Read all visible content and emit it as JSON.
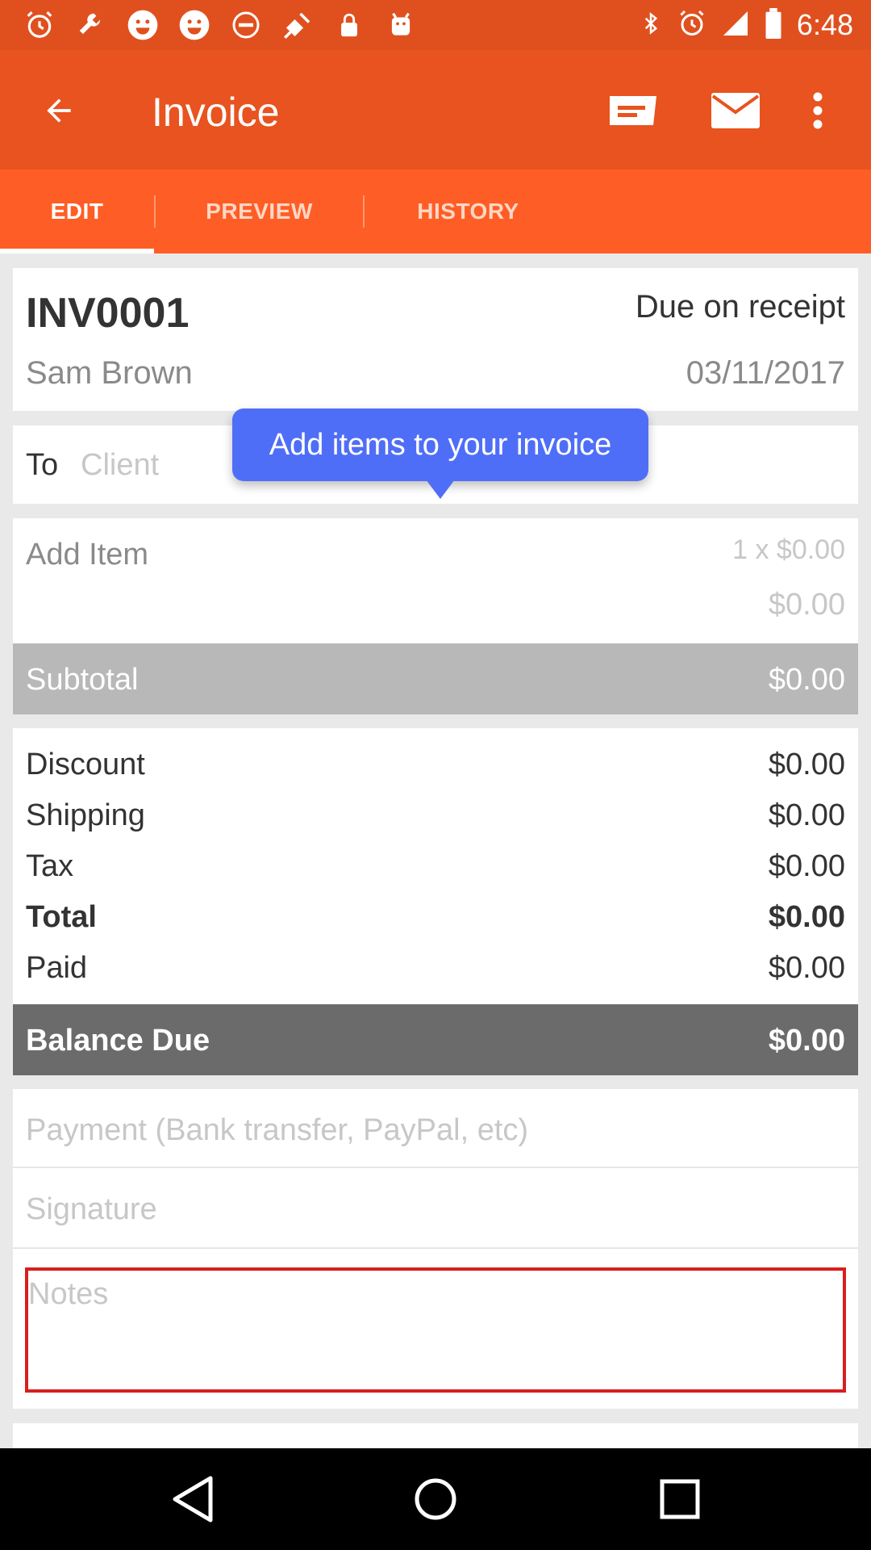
{
  "status_bar": {
    "time": "6:48",
    "left_icons": [
      "alarm-icon",
      "wrench-icon",
      "smiley-icon",
      "smiley-icon",
      "no-entry-icon",
      "satellite-fake-gps-icon",
      "lock-icon",
      "android-icon"
    ],
    "right_icons": [
      "bluetooth-icon",
      "alarm-icon",
      "signal-icon",
      "battery-icon"
    ]
  },
  "app_bar": {
    "title": "Invoice",
    "actions": [
      "save-icon",
      "mail-icon",
      "more-vert-icon"
    ]
  },
  "tabs": [
    {
      "label": "EDIT",
      "active": true
    },
    {
      "label": "PREVIEW",
      "active": false
    },
    {
      "label": "HISTORY",
      "active": false
    }
  ],
  "header": {
    "invoice_number": "INV0001",
    "terms": "Due on receipt",
    "from_name": "Sam Brown",
    "date": "03/11/2017"
  },
  "client": {
    "to_label": "To",
    "placeholder": "Client"
  },
  "tooltip": {
    "text": "Add items to your invoice"
  },
  "item": {
    "label": "Add Item",
    "qty_price": "1 x $0.00",
    "amount": "$0.00"
  },
  "subtotal": {
    "label": "Subtotal",
    "value": "$0.00"
  },
  "totals": [
    {
      "label": "Discount",
      "value": "$0.00",
      "bold": false
    },
    {
      "label": "Shipping",
      "value": "$0.00",
      "bold": false
    },
    {
      "label": "Tax",
      "value": "$0.00",
      "bold": false
    },
    {
      "label": "Total",
      "value": "$0.00",
      "bold": true
    },
    {
      "label": "Paid",
      "value": "$0.00",
      "bold": false
    }
  ],
  "balance_due": {
    "label": "Balance Due",
    "value": "$0.00"
  },
  "payment": {
    "placeholder": "Payment (Bank transfer, PayPal, etc)"
  },
  "signature": {
    "placeholder": "Signature"
  },
  "notes": {
    "placeholder": "Notes"
  },
  "colors": {
    "status_bar": "#e0501f",
    "app_bar": "#e8531f",
    "tab_bar": "#fe5e26",
    "tooltip": "#4f6ef7",
    "subtotal_bg": "#b8b8b8",
    "balance_bg": "#6b6b6b",
    "notes_border": "#d81e1e"
  }
}
